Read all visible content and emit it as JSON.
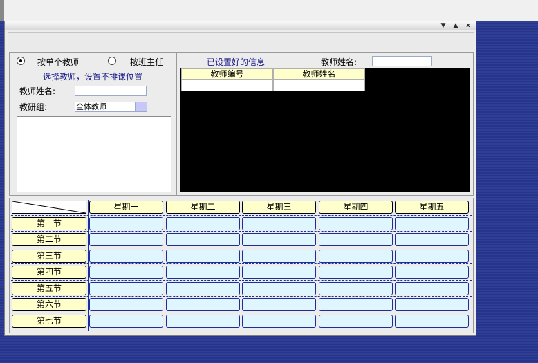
{
  "controls": {
    "dropdown_symbol": "▼",
    "minimize_symbol": "▲",
    "close_symbol": "x"
  },
  "mode": {
    "single_teacher": "按单个教师",
    "class_head": "按班主任",
    "selected": "single_teacher"
  },
  "left_panel": {
    "instruction": "选择教师，设置不排课位置",
    "teacher_name_label": "教师姓名:",
    "teacher_name_value": "",
    "group_label": "教研组:",
    "group_value": "全体教师"
  },
  "right_panel": {
    "title": "已设置好的信息",
    "teacher_name_label": "教师姓名:",
    "teacher_name_value": "",
    "columns": [
      "教师编号",
      "教师姓名"
    ]
  },
  "schedule": {
    "days": [
      "星期一",
      "星期二",
      "星期三",
      "星期四",
      "星期五"
    ],
    "periods": [
      "第一节",
      "第二节",
      "第三节",
      "第四节",
      "第五节",
      "第六节",
      "第七节"
    ]
  },
  "colors": {
    "header_bg": "#ffffcc",
    "cell_bg": "#dff6ff",
    "cell_border": "#1a2f9a",
    "grid_bg": "#000000",
    "desktop": "#2b3a8f"
  }
}
